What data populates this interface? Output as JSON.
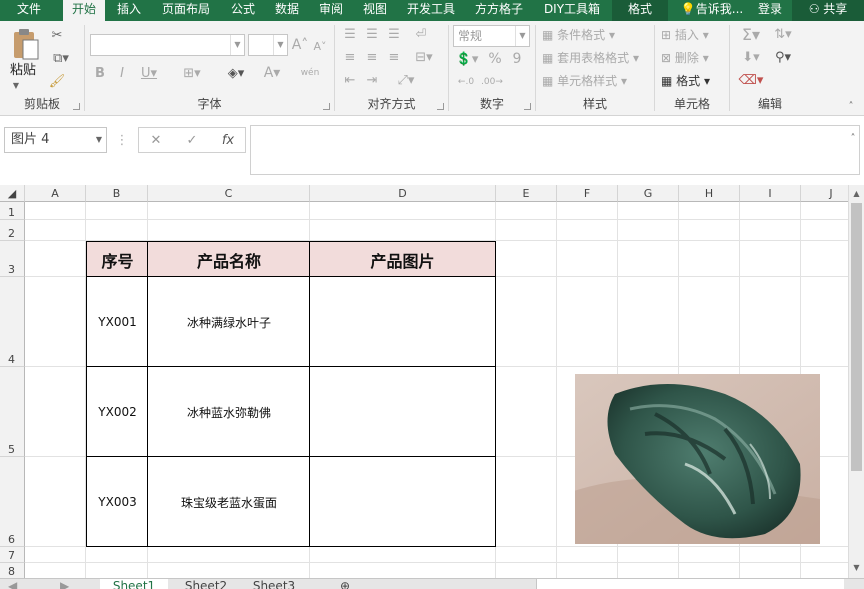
{
  "ribbon_tabs": [
    {
      "label": "文件",
      "active": false
    },
    {
      "label": "开始",
      "active": true
    },
    {
      "label": "插入",
      "active": false
    },
    {
      "label": "页面布局",
      "active": false
    },
    {
      "label": "公式",
      "active": false
    },
    {
      "label": "数据",
      "active": false
    },
    {
      "label": "审阅",
      "active": false
    },
    {
      "label": "视图",
      "active": false
    },
    {
      "label": "开发工具",
      "active": false
    },
    {
      "label": "方方格子",
      "active": false
    },
    {
      "label": "DIY工具箱",
      "active": false
    },
    {
      "label": "格式",
      "active": false
    }
  ],
  "tellme": "告诉我...",
  "login": "登录",
  "share": "共享",
  "clipboard": {
    "paste": "粘贴",
    "label": "剪贴板"
  },
  "font": {
    "label": "字体",
    "wen": "wén"
  },
  "alignment": {
    "label": "对齐方式"
  },
  "number": {
    "format": "常规",
    "label": "数字",
    "percent": "%",
    "comma": "9"
  },
  "styles": {
    "conditional": "条件格式",
    "table": "套用表格格式",
    "cell": "单元格样式",
    "label": "样式"
  },
  "cells": {
    "insert": "插入",
    "delete": "删除",
    "format": "格式",
    "label": "单元格"
  },
  "editing": {
    "label": "编辑"
  },
  "namebox": "图片 4",
  "formula": {
    "fx": "fx",
    "value": ""
  },
  "columns": [
    "A",
    "B",
    "C",
    "D",
    "E",
    "F",
    "G",
    "H",
    "I",
    "J"
  ],
  "rows": [
    "1",
    "2",
    "3",
    "4",
    "5",
    "6",
    "7",
    "8"
  ],
  "table": {
    "headers": [
      "序号",
      "产品名称",
      "产品图片"
    ],
    "rows": [
      {
        "id": "YX001",
        "name": "冰种满绿水叶子"
      },
      {
        "id": "YX002",
        "name": "冰种蓝水弥勒佛"
      },
      {
        "id": "YX003",
        "name": "珠宝级老蓝水蛋面"
      }
    ]
  },
  "sheets": [
    "Sheet1",
    "Sheet2",
    "Sheet3"
  ],
  "colors": {
    "accent": "#217346",
    "header_fill": "#f2dcdb"
  }
}
